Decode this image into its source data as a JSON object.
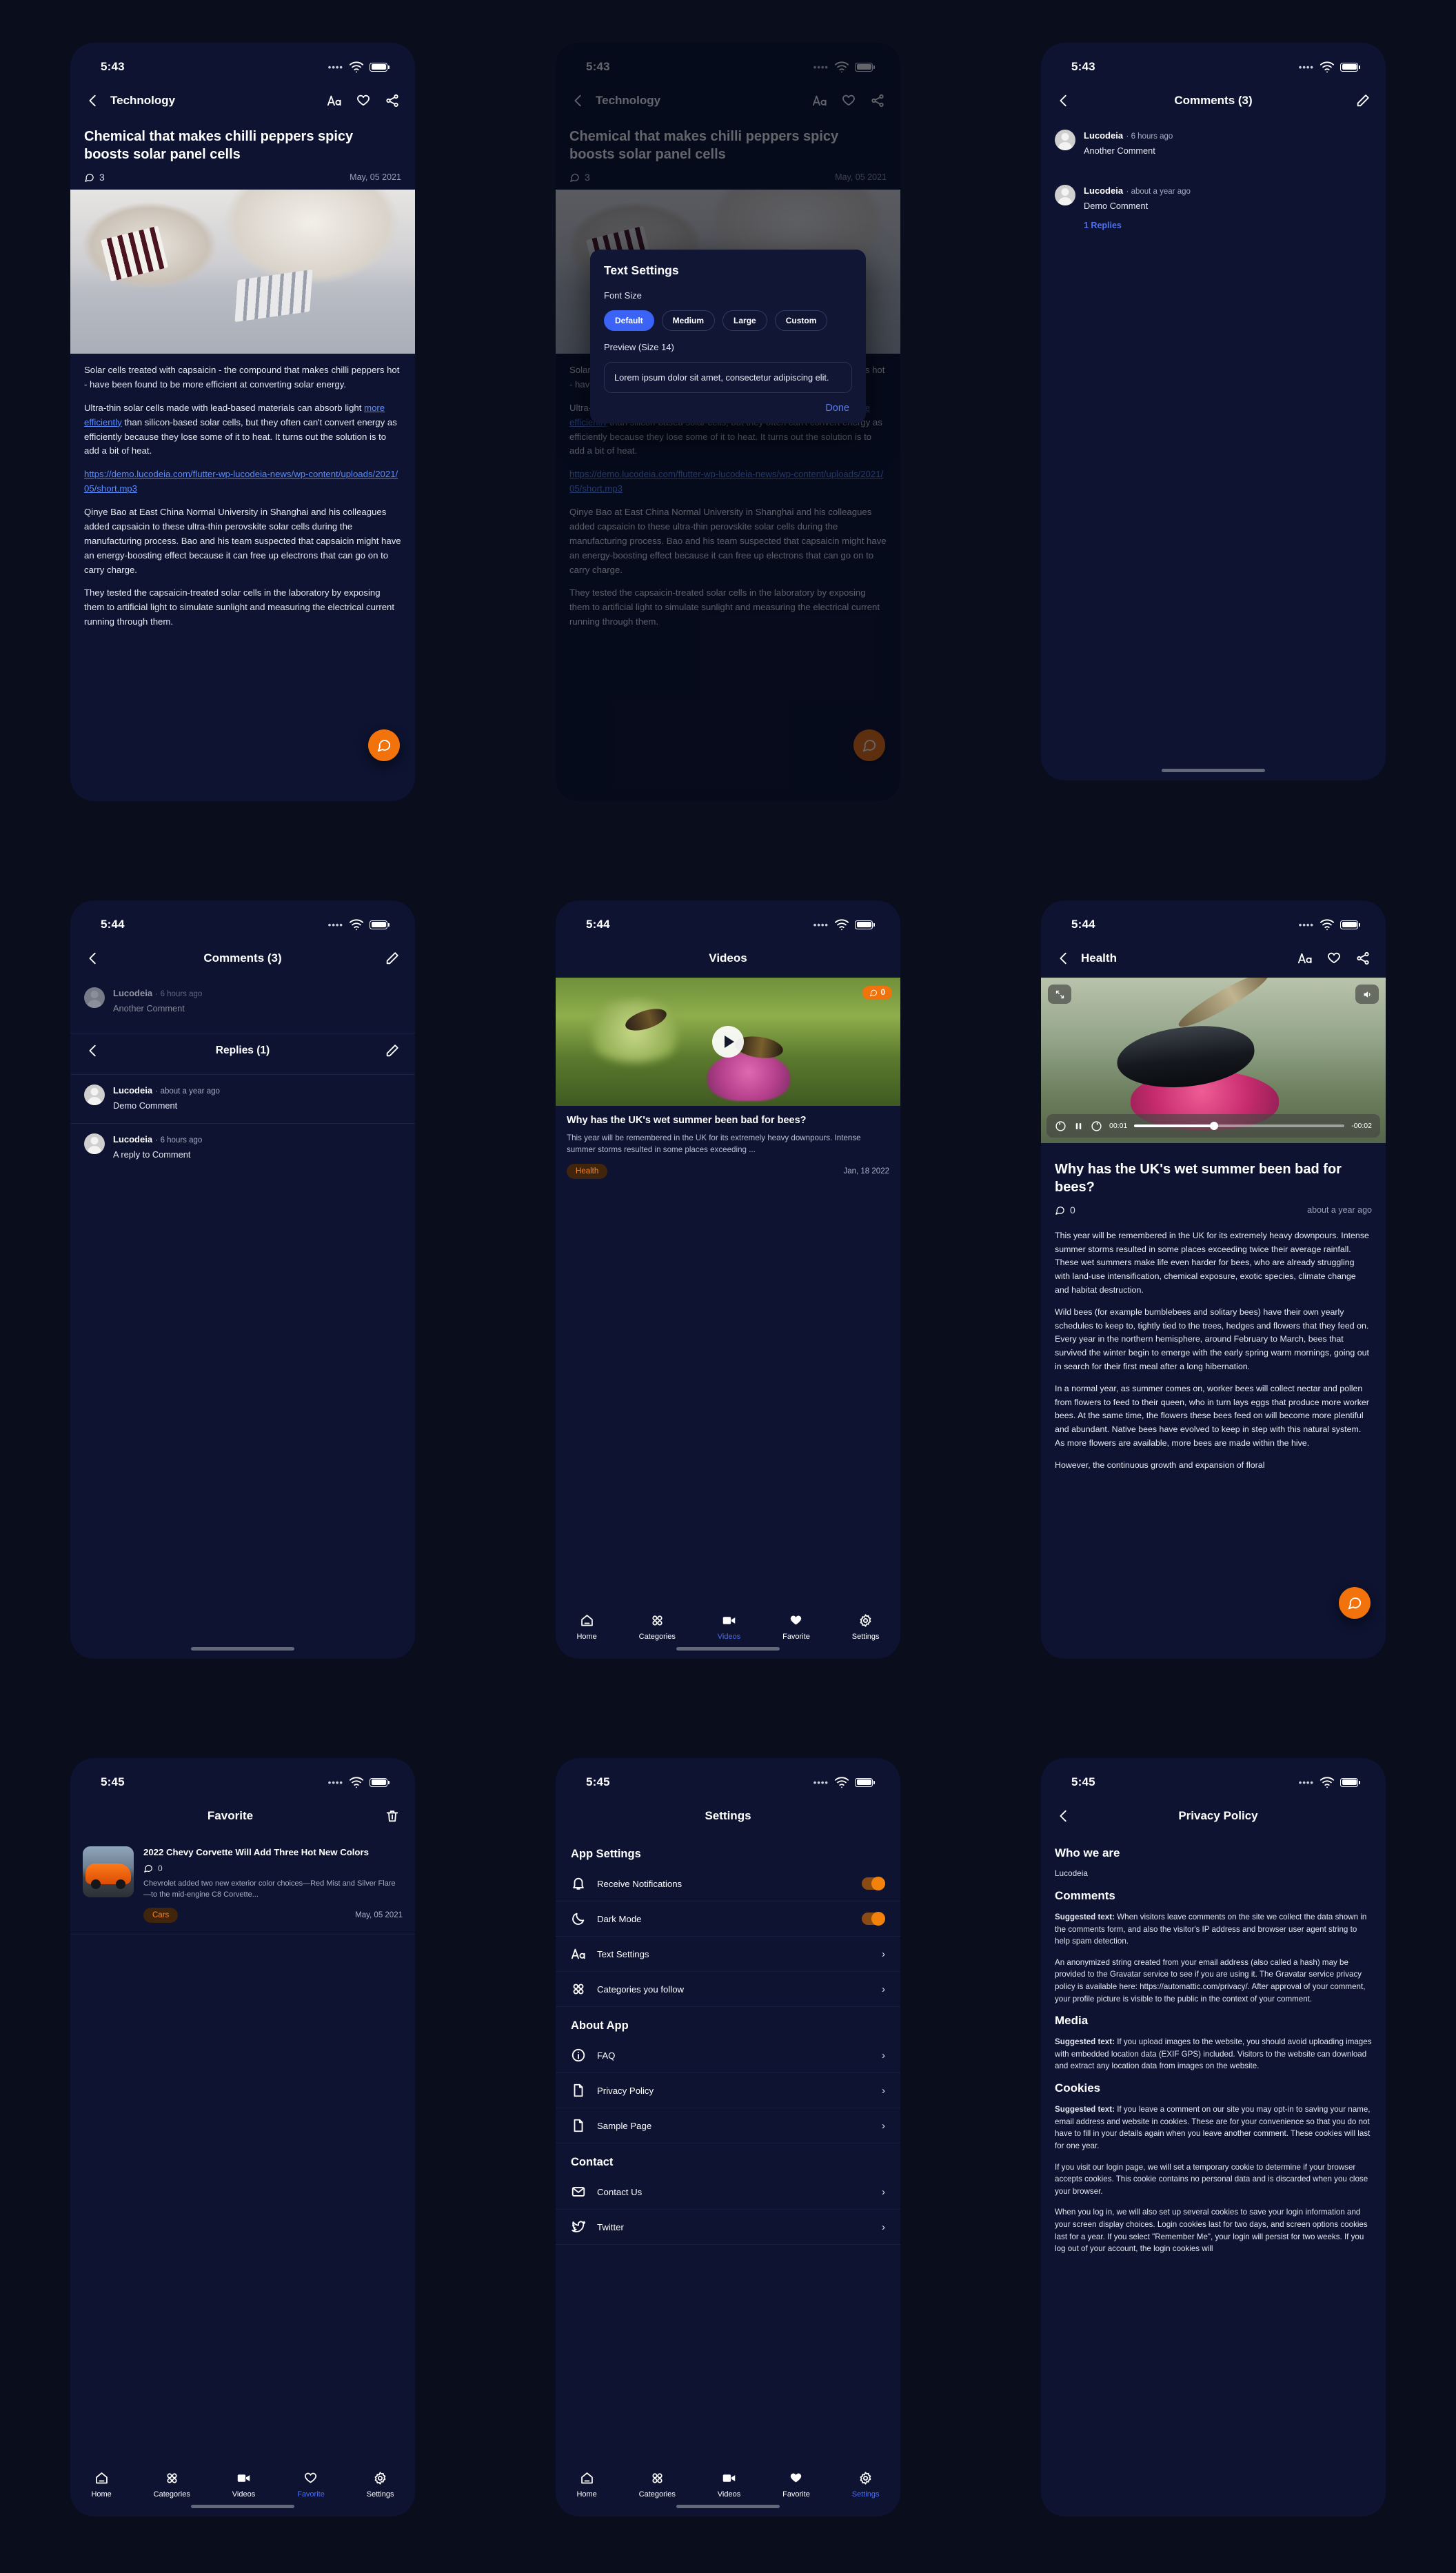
{
  "panels": {
    "article": {
      "time": "5:43",
      "nav_title": "Technology",
      "title": "Chemical that makes chilli peppers spicy boosts solar panel cells",
      "comment_count": "3",
      "date": "May, 05 2021",
      "p1": "Solar cells treated with capsaicin - the compound that makes chilli peppers hot - have been found to be more efficient at converting solar energy.",
      "p2_a": "Ultra-thin solar cells made with lead-based materials can absorb light ",
      "p2_link": "more efficiently",
      "p2_b": " than silicon-based solar cells, but they often can't convert energy as efficiently because they lose some of it to heat. It turns out the solution is to add a bit of heat.",
      "audio_link": "https://demo.lucodeia.com/flutter-wp-lucodeia-news/wp-content/uploads/2021/05/short.mp3",
      "p3": "Qinye Bao at East China Normal University in Shanghai and his colleagues added capsaicin to these ultra-thin perovskite solar cells during the manufacturing process. Bao and his team suspected that capsaicin might have an energy-boosting effect because it can free up electrons that can go on to carry charge.",
      "p4": "They tested the capsaicin-treated solar cells in the laboratory by exposing them to artificial light to simulate sunlight and measuring the electrical current running through them."
    },
    "text_settings": {
      "time": "5:43",
      "nav_title": "Technology",
      "sheet_title": "Text Settings",
      "font_size_label": "Font Size",
      "chips": [
        "Default",
        "Medium",
        "Large",
        "Custom"
      ],
      "selected_chip": "Default",
      "preview_label": "Preview (Size 14)",
      "preview_text": "Lorem ipsum dolor sit amet, consectetur adipiscing elit.",
      "done_label": "Done"
    },
    "comments": {
      "time": "5:43",
      "title": "Comments (3)",
      "items": [
        {
          "name": "Lucodeia",
          "ago": "6 hours ago",
          "text": "Another Comment"
        },
        {
          "name": "Lucodeia",
          "ago": "about a year ago",
          "text": "Demo Comment",
          "replies": "1 Replies"
        }
      ]
    },
    "replies": {
      "time": "5:44",
      "title": "Comments (3)",
      "top_comment": {
        "name": "Lucodeia",
        "ago": "6 hours ago",
        "text": "Another Comment"
      },
      "replies_title": "Replies (1)",
      "items": [
        {
          "name": "Lucodeia",
          "ago": "about a year ago",
          "text": "Demo Comment"
        },
        {
          "name": "Lucodeia",
          "ago": "6 hours ago",
          "text": "A reply to Comment"
        }
      ]
    },
    "videos": {
      "time": "5:44",
      "title": "Videos",
      "badge": "0",
      "card_title": "Why has the UK's wet summer been bad for bees?",
      "card_excerpt": "This year will be remembered in the UK for its extremely heavy downpours. Intense summer storms resulted in some places exceeding ...",
      "tag": "Health",
      "date": "Jan, 18 2022"
    },
    "health": {
      "time": "5:44",
      "nav_title": "Health",
      "elapsed": "00:01",
      "remaining": "-00:02",
      "title": "Why has the UK's wet summer been bad for bees?",
      "comment_count": "0",
      "ago": "about a year ago",
      "p1": "This year will be remembered in the UK for its extremely heavy downpours. Intense summer storms resulted in some places exceeding twice their average rainfall. These wet summers make life even harder for bees, who are already struggling with land-use intensification, chemical exposure, exotic species, climate change and habitat destruction.",
      "p2": "Wild bees (for example bumblebees and solitary bees) have their own yearly schedules to keep to, tightly tied to the trees, hedges and flowers that they feed on. Every year in the northern hemisphere, around February to March, bees that survived the winter begin to emerge with the early spring warm mornings, going out in search for their first meal after a long hibernation.",
      "p3": "In a normal year, as summer comes on, worker bees will collect nectar and pollen from flowers to feed to their queen, who in turn lays eggs that produce more worker bees. At the same time, the flowers these bees feed on will become more plentiful and abundant. Native bees have evolved to keep in step with this natural system. As more flowers are available, more bees are made within the hive.",
      "p4": "However, the continuous growth and expansion of floral"
    },
    "favorite": {
      "time": "5:45",
      "title": "Favorite",
      "item": {
        "title": "2022 Chevy Corvette Will Add Three Hot New Colors",
        "comment_count": "0",
        "excerpt": "Chevrolet added two new exterior color choices—Red Mist and Silver Flare—to the mid-engine C8 Corvette...",
        "tag": "Cars",
        "date": "May, 05 2021"
      }
    },
    "settings": {
      "time": "5:45",
      "title": "Settings",
      "groups": [
        {
          "header": "App Settings",
          "rows": [
            {
              "icon": "bell-icon",
              "label": "Receive Notifications",
              "control": "toggle"
            },
            {
              "icon": "moon-icon",
              "label": "Dark Mode",
              "control": "toggle"
            },
            {
              "icon": "aa-icon",
              "label": "Text Settings",
              "control": "chevron"
            },
            {
              "icon": "grid-icon",
              "label": "Categories you follow",
              "control": "chevron"
            }
          ]
        },
        {
          "header": "About App",
          "rows": [
            {
              "icon": "info-icon",
              "label": "FAQ",
              "control": "chevron"
            },
            {
              "icon": "doc-icon",
              "label": "Privacy Policy",
              "control": "chevron"
            },
            {
              "icon": "doc-icon",
              "label": "Sample Page",
              "control": "chevron"
            }
          ]
        },
        {
          "header": "Contact",
          "rows": [
            {
              "icon": "mail-icon",
              "label": "Contact Us",
              "control": "chevron"
            },
            {
              "icon": "twitter-icon",
              "label": "Twitter",
              "control": "chevron"
            }
          ]
        }
      ]
    },
    "privacy": {
      "time": "5:45",
      "title": "Privacy Policy",
      "h_who": "Who we are",
      "who_name": "Lucodeia",
      "h_comments": "Comments",
      "c_p1_b": "Suggested text:",
      "c_p1": " When visitors leave comments on the site we collect the data shown in the comments form, and also the visitor's IP address and browser user agent string to help spam detection.",
      "c_p2": "An anonymized string created from your email address (also called a hash) may be provided to the Gravatar service to see if you are using it. The Gravatar service privacy policy is available here: https://automattic.com/privacy/. After approval of your comment, your profile picture is visible to the public in the context of your comment.",
      "h_media": "Media",
      "m_p1_b": "Suggested text:",
      "m_p1": " If you upload images to the website, you should avoid uploading images with embedded location data (EXIF GPS) included. Visitors to the website can download and extract any location data from images on the website.",
      "h_cookies": "Cookies",
      "k_p1_b": "Suggested text:",
      "k_p1": " If you leave a comment on our site you may opt-in to saving your name, email address and website in cookies. These are for your convenience so that you do not have to fill in your details again when you leave another comment. These cookies will last for one year.",
      "k_p2": "If you visit our login page, we will set a temporary cookie to determine if your browser accepts cookies. This cookie contains no personal data and is discarded when you close your browser.",
      "k_p3": "When you log in, we will also set up several cookies to save your login information and your screen display choices. Login cookies last for two days, and screen options cookies last for a year. If you select \"Remember Me\", your login will persist for two weeks. If you log out of your account, the login cookies will"
    }
  },
  "tabbar": {
    "items": [
      {
        "label": "Home",
        "icon": "home-icon"
      },
      {
        "label": "Categories",
        "icon": "grid-icon"
      },
      {
        "label": "Videos",
        "icon": "video-icon"
      },
      {
        "label": "Favorite",
        "icon": "heart-icon"
      },
      {
        "label": "Settings",
        "icon": "gear-icon"
      }
    ]
  },
  "colors": {
    "accent_orange": "#f2720c",
    "accent_blue": "#3b63f6",
    "bg": "#0d1330"
  }
}
